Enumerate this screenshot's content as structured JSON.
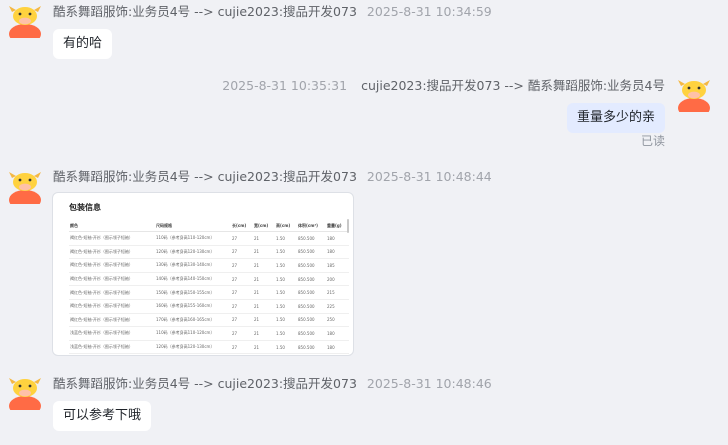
{
  "messages": [
    {
      "sender": "酷系舞蹈服饰:业务员4号 --> cujie2023:搜品开发073",
      "time": "2025-8-31 10:34:59",
      "text": "有的哈"
    },
    {
      "sender": "cujie2023:搜品开发073 --> 酷系舞蹈服饰:业务员4号",
      "time": "2025-8-31 10:35:31",
      "text": "重量多少的亲",
      "status": "已读"
    },
    {
      "sender": "酷系舞蹈服饰:业务员4号 --> cujie2023:搜品开发073",
      "time": "2025-8-31 10:48:44",
      "image": {
        "title": "包装信息",
        "columns": [
          "颜色",
          "尺码规格",
          "长(cm)",
          "宽(cm)",
          "高(cm)",
          "体积(cm³)",
          "重量(g)"
        ],
        "rows": [
          [
            "褐红色-短袖-开衫（图示领子短袖）",
            "110码（参考身高110-120cm）",
            "27",
            "21",
            "1.50",
            "850.500",
            "180"
          ],
          [
            "褐红色-短袖-开衫（图示领子短袖）",
            "120码（参考身高120-130cm）",
            "27",
            "21",
            "1.50",
            "850.500",
            "180"
          ],
          [
            "褐红色-短袖-开衫（图示领子短袖）",
            "130码（参考身高130-140cm）",
            "27",
            "21",
            "1.50",
            "850.500",
            "185"
          ],
          [
            "褐红色-短袖-开衫（图示领子短袖）",
            "140码（参考身高140-150cm）",
            "27",
            "21",
            "1.50",
            "850.500",
            "200"
          ],
          [
            "褐红色-短袖-开衫（图示领子短袖）",
            "150码（参考身高150-155cm）",
            "27",
            "21",
            "1.50",
            "850.500",
            "215"
          ],
          [
            "褐红色-短袖-开衫（图示领子短袖）",
            "160码（参考身高155-160cm）",
            "27",
            "21",
            "1.50",
            "850.500",
            "225"
          ],
          [
            "褐红色-短袖-开衫（图示领子短袖）",
            "170码（参考身高160-165cm）",
            "27",
            "21",
            "1.50",
            "850.500",
            "250"
          ],
          [
            "浅蓝色-短袖-开衫（图示领子短袖）",
            "110码（参考身高110-120cm）",
            "27",
            "21",
            "1.50",
            "850.500",
            "180"
          ],
          [
            "浅蓝色-短袖-开衫（图示领子短袖）",
            "120码（参考身高120-130cm）",
            "27",
            "21",
            "1.50",
            "850.500",
            "180"
          ],
          [
            "浅蓝色-短袖-开衫（图示领子短袖）",
            "130码（参考身高130-140cm）",
            "27",
            "21",
            "1.50",
            "850.500",
            "185"
          ]
        ]
      }
    },
    {
      "sender": "酷系舞蹈服饰:业务员4号 --> cujie2023:搜品开发073",
      "time": "2025-8-31 10:48:46",
      "text": "可以参考下哦"
    }
  ],
  "colors": {
    "background": "#f0f1f5",
    "bubble_other": "#ffffff",
    "bubble_mine": "#e3ebff",
    "avatar_body": "#ff6b45",
    "avatar_face": "#ffd23f"
  },
  "icons": {
    "avatar": "cartoon-bull-avatar-icon"
  }
}
